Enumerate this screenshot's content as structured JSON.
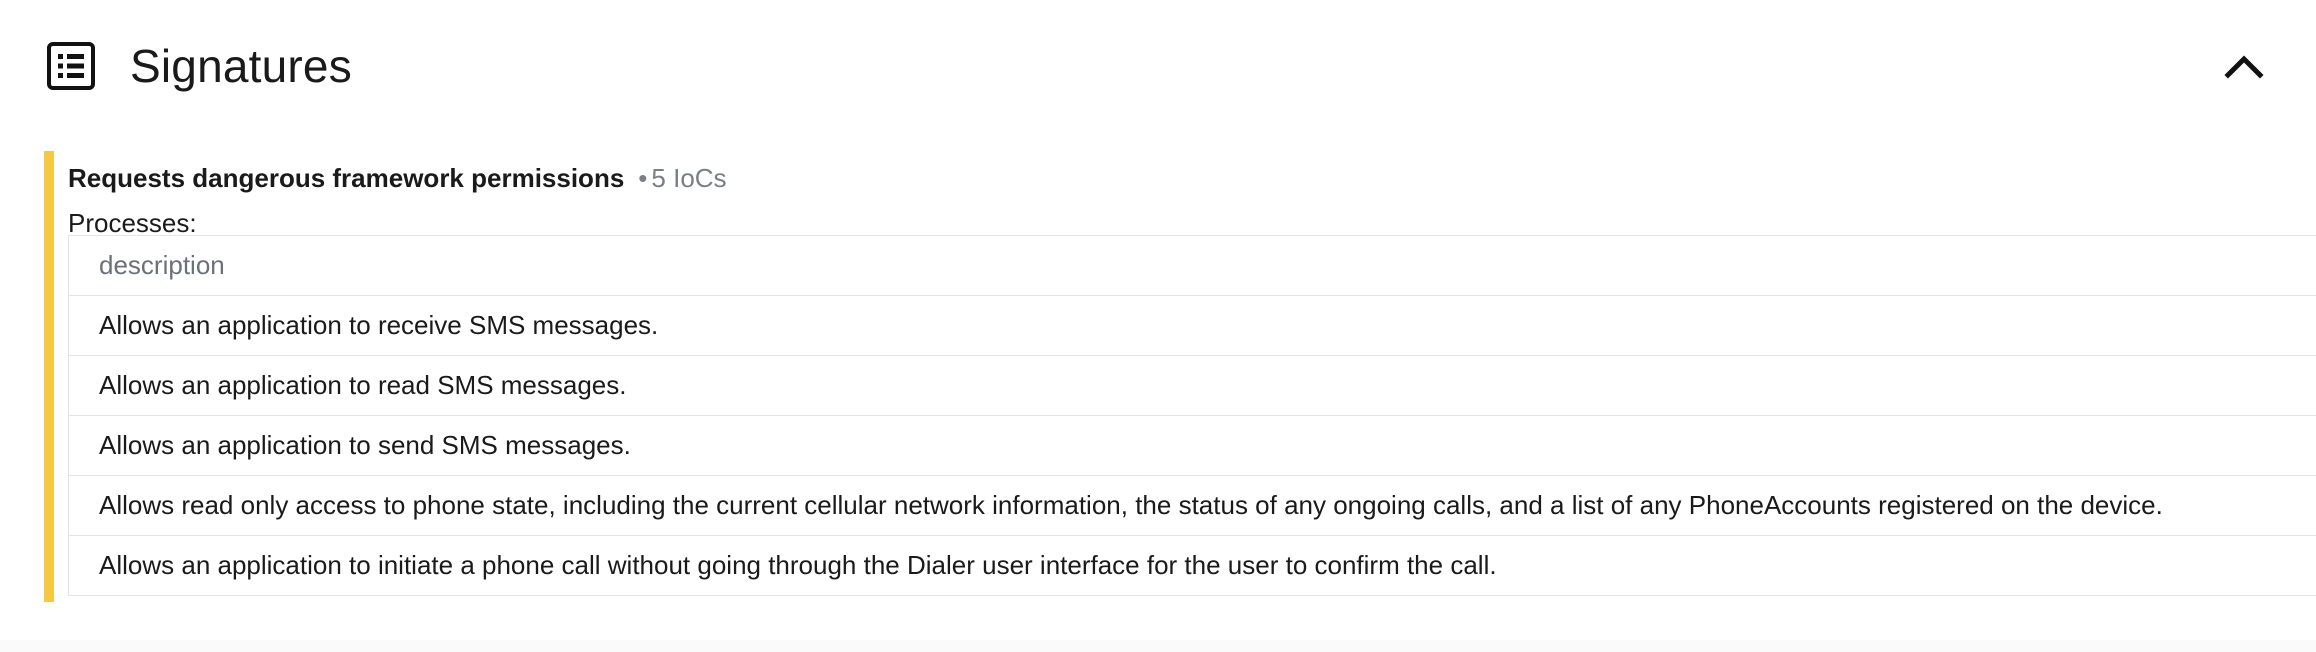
{
  "section": {
    "title": "Signatures",
    "icon": "list-icon",
    "collapse_icon": "chevron-up-icon"
  },
  "signature": {
    "name": "Requests dangerous framework permissions",
    "separator": "•",
    "ioc_count": "5 IoCs",
    "accent_color": "#f7c843",
    "processes_label": "Processes:",
    "table": {
      "header": "description",
      "rows": [
        "Allows an application to receive SMS messages.",
        "Allows an application to read SMS messages.",
        "Allows an application to send SMS messages.",
        "Allows read only access to phone state, including the current cellular network information, the status of any ongoing calls, and a list of any PhoneAccounts registered on the device.",
        "Allows an application to initiate a phone call without going through the Dialer user interface for the user to confirm the call."
      ]
    }
  }
}
